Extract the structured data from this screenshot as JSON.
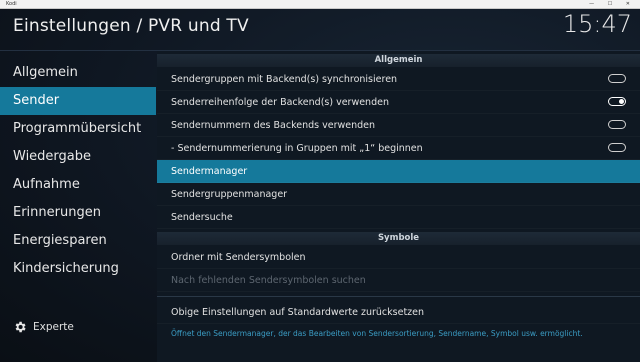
{
  "window": {
    "title": "Kodi",
    "controls": "— ☐ ✕"
  },
  "header": {
    "title": "Einstellungen / PVR und TV",
    "clock": "15:47"
  },
  "sidebar": {
    "items": [
      {
        "label": "Allgemein"
      },
      {
        "label": "Sender"
      },
      {
        "label": "Programmübersicht"
      },
      {
        "label": "Wiedergabe"
      },
      {
        "label": "Aufnahme"
      },
      {
        "label": "Erinnerungen"
      },
      {
        "label": "Energiesparen"
      },
      {
        "label": "Kindersicherung"
      }
    ],
    "active_index": 1,
    "expert_label": "Experte",
    "expert_icon": "gear-icon"
  },
  "panel": {
    "section_general": "Allgemein",
    "settings": [
      {
        "label": "Sendergruppen mit Backend(s) synchronisieren",
        "toggle": "off"
      },
      {
        "label": "Senderreihenfolge der Backend(s) verwenden",
        "toggle": "on"
      },
      {
        "label": "Sendernummern des Backends verwenden",
        "toggle": "off"
      },
      {
        "label": "- Sendernummerierung in Gruppen mit „1“ beginnen",
        "toggle": "off"
      },
      {
        "label": "Sendermanager",
        "selected": true
      },
      {
        "label": "Sendergruppenmanager"
      },
      {
        "label": "Sendersuche"
      }
    ],
    "section_symbols": "Symbole",
    "symbol_settings": [
      {
        "label": "Ordner mit Sendersymbolen"
      },
      {
        "label": "Nach fehlenden Sendersymbolen suchen",
        "disabled": true
      }
    ],
    "reset_label": "Obige Einstellungen auf Standardwerte zurücksetzen",
    "description": "Öffnet den Sendermanager, der das Bearbeiten von Sendersortierung, Sendername, Symbol usw. ermöglicht."
  },
  "colors": {
    "accent": "#15799b",
    "description_text": "#3b9cc4"
  }
}
